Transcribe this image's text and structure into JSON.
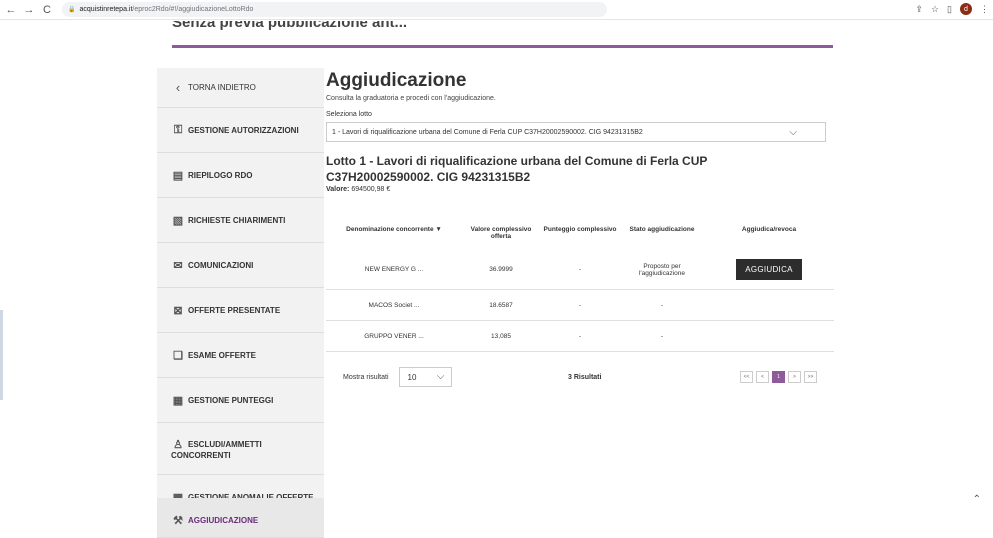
{
  "browser": {
    "back": "←",
    "forward": "→",
    "reload": "C",
    "url_host": "acquistinretepa.it",
    "url_path": "/eproc2Rdo/#!/aggiudicazioneLottoRdo",
    "profile_initial": "d"
  },
  "header": {
    "clipped_title": "Senza previa pubblicazione ant..."
  },
  "sidebar": {
    "items": [
      {
        "label": "TORNA INDIETRO"
      },
      {
        "label": "GESTIONE AUTORIZZAZIONI"
      },
      {
        "label": "RIEPILOGO RDO"
      },
      {
        "label": "RICHIESTE CHIARIMENTI"
      },
      {
        "label": "COMUNICAZIONI"
      },
      {
        "label": "OFFERTE PRESENTATE"
      },
      {
        "label": "ESAME OFFERTE"
      },
      {
        "label": "GESTIONE PUNTEGGI"
      },
      {
        "label_line1": "ESCLUDI/AMMETTI",
        "label_line2": "CONCORRENTI"
      },
      {
        "label": "GESTIONE ANOMALIE OFFERTE"
      },
      {
        "label": "AGGIUDICAZIONE"
      }
    ]
  },
  "main": {
    "title": "Aggiudicazione",
    "subtitle": "Consulta la graduatoria e procedi con l'aggiudicazione.",
    "select_label": "Seleziona lotto",
    "select_value": "1 - Lavori di riqualificazione urbana del Comune di Ferla CUP C37H20002590002. CIG 94231315B2",
    "lot_title": "Lotto 1 - Lavori di riqualificazione urbana del Comune di Ferla CUP C37H20002590002. CIG 94231315B2",
    "value_label": "Valore:",
    "value": "694500,98 €"
  },
  "table": {
    "headers": {
      "c1": "Denominazione concorrente ▼",
      "c2": "Valore complessivo offerta",
      "c3": "Punteggio complessivo",
      "c4": "Stato aggiudicazione",
      "c5": "Aggiudica/revoca"
    },
    "rows": [
      {
        "name": "NEW ENERGY G ...",
        "value": "36.9999",
        "score": "-",
        "status": "Proposto per l'aggiudicazione",
        "action": "AGGIUDICA"
      },
      {
        "name": "MACOS Societ ...",
        "value": "18.6587",
        "score": "-",
        "status": "-",
        "action": ""
      },
      {
        "name": "GRUPPO VENER ...",
        "value": "13,085",
        "score": "-",
        "status": "-",
        "action": ""
      }
    ]
  },
  "footer": {
    "show_label": "Mostra risultati",
    "per_page": "10",
    "results": "3 Risultati",
    "pager": {
      "first": "<<",
      "prev": "<",
      "current": "1",
      "next": ">",
      "last": ">>"
    }
  },
  "colors": {
    "accent": "#8e5a9b",
    "button": "#2d2d2d",
    "sidebar_bg": "#f2f2f2"
  }
}
